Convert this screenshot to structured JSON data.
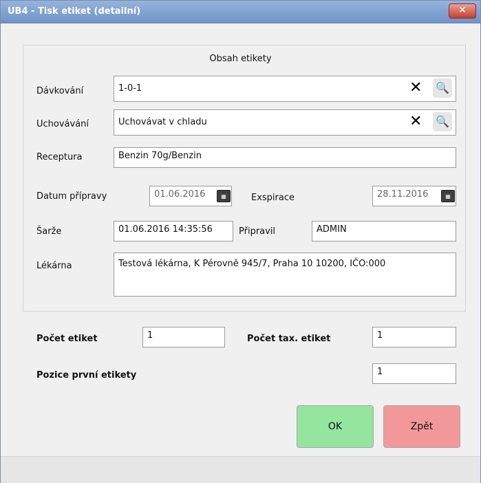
{
  "window": {
    "title": "UB4 - Tisk etiket (detailní)",
    "close_glyph": "✕"
  },
  "label_content": {
    "group_title": "Obsah etikety",
    "dosage_label": "Dávkování",
    "dosage_value": "1-0-1",
    "storage_label": "Uchovávání",
    "storage_value": "Uchovávat v chladu",
    "recipe_label": "Receptura",
    "recipe_value": "Benzin 70g/Benzin",
    "prep_date_label": "Datum přípravy",
    "prep_date_value": "01.06.2016",
    "expiry_label": "Exspirace",
    "expiry_value": "28.11.2016",
    "batch_label": "Šarže",
    "batch_value": "01.06.2016 14:35:56",
    "prepared_by_label": "Připravil",
    "prepared_by_value": "ADMIN",
    "pharmacy_label": "Lékárna",
    "pharmacy_value": "Testová lékárna, K Pérovně 945/7, Praha 10 10200, IČO:000"
  },
  "icons": {
    "clear_glyph": "✕",
    "search_glyph": "🔍",
    "calendar_glyph": "▦"
  },
  "counts": {
    "labels_count_label": "Počet etiket",
    "labels_count_value": "1",
    "tax_labels_count_label": "Počet tax. etiket",
    "tax_labels_count_value": "1",
    "first_label_position_label": "Pozice první etikety",
    "first_label_position_value": "1"
  },
  "buttons": {
    "ok_label": "OK",
    "back_label": "Zpět"
  },
  "colors": {
    "ok": "#94e59e",
    "back": "#f3989a",
    "titlebar": "#7a9bcd"
  }
}
